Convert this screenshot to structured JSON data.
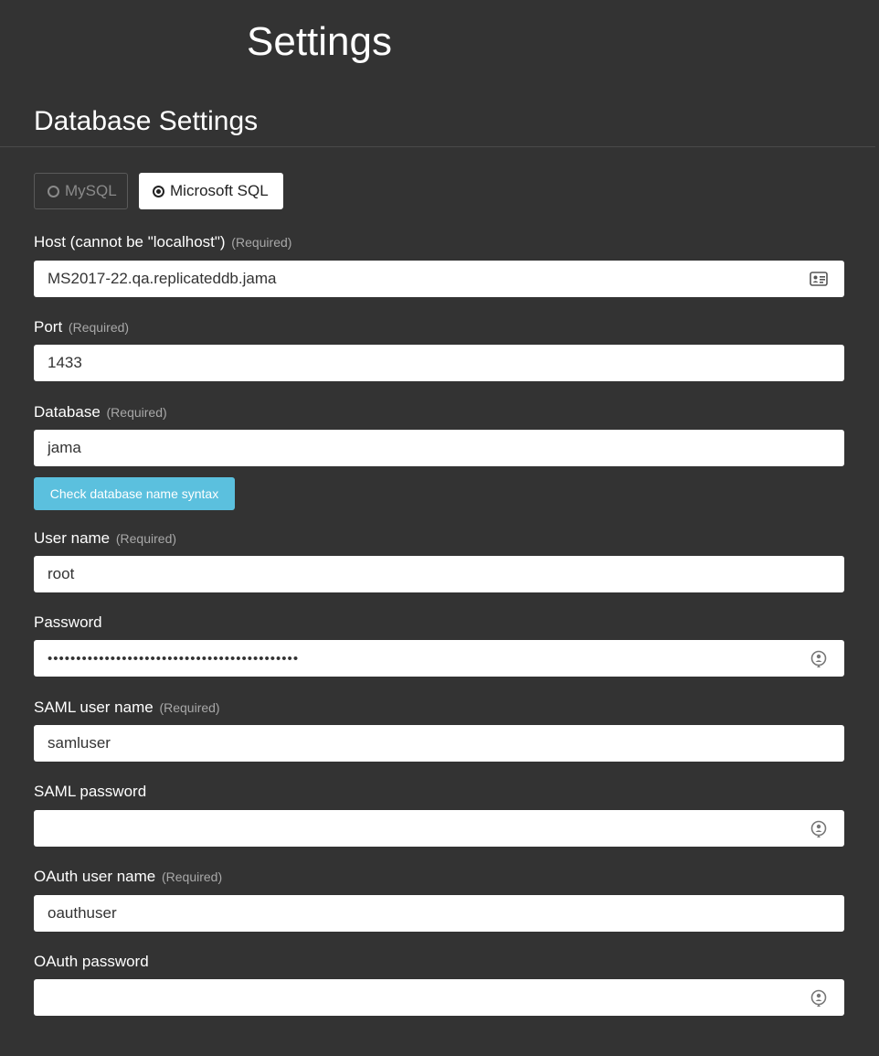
{
  "page": {
    "title": "Settings"
  },
  "section": {
    "title": "Database Settings"
  },
  "db_type": {
    "options": [
      {
        "label": "MySQL",
        "selected": false
      },
      {
        "label": "Microsoft SQL",
        "selected": true
      }
    ]
  },
  "required_tag": "(Required)",
  "fields": {
    "host": {
      "label": "Host (cannot be \"localhost\")",
      "required": true,
      "value": "MS2017-22.qa.replicateddb.jama",
      "icon": "contact-card-icon"
    },
    "port": {
      "label": "Port",
      "required": true,
      "value": "1433"
    },
    "database": {
      "label": "Database",
      "required": true,
      "value": "jama"
    },
    "username": {
      "label": "User name",
      "required": true,
      "value": "root"
    },
    "password": {
      "label": "Password",
      "required": false,
      "value": "••••••••••••••••••••••••••••••••••••••••••••",
      "icon": "password-manager-icon"
    },
    "saml_username": {
      "label": "SAML user name",
      "required": true,
      "value": "samluser"
    },
    "saml_password": {
      "label": "SAML password",
      "required": false,
      "value": "",
      "icon": "password-manager-icon"
    },
    "oauth_username": {
      "label": "OAuth user name",
      "required": true,
      "value": "oauthuser"
    },
    "oauth_password": {
      "label": "OAuth password",
      "required": false,
      "value": "",
      "icon": "password-manager-icon"
    }
  },
  "check_button": {
    "label": "Check database name syntax"
  },
  "colors": {
    "background": "#333333",
    "accent": "#5bc0de",
    "input_bg": "#ffffff"
  }
}
